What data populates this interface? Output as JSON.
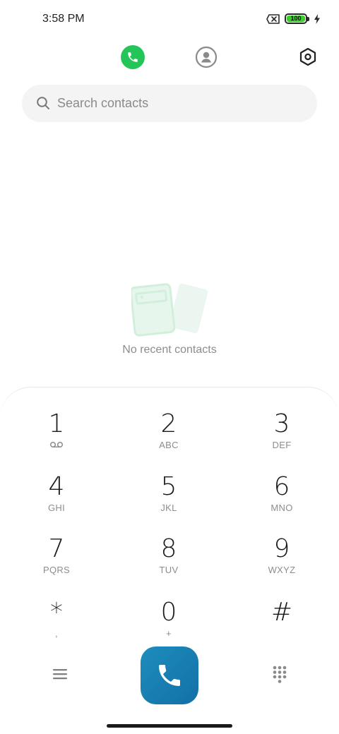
{
  "status_bar": {
    "time": "3:58 PM",
    "battery_level": "100",
    "icons": [
      "no-sim-icon",
      "battery-icon",
      "charging-bolt-icon"
    ]
  },
  "top_nav": {
    "tabs": [
      {
        "name": "phone-tab-icon",
        "active": true,
        "color": "#23c559"
      },
      {
        "name": "contacts-tab-icon",
        "active": false
      },
      {
        "name": "settings-icon",
        "active": false
      }
    ]
  },
  "search": {
    "placeholder": "Search contacts",
    "value": ""
  },
  "empty_state": {
    "message": "No recent contacts"
  },
  "dialpad": {
    "keys": [
      {
        "digit": "1",
        "letters": "",
        "extra_icon": "voicemail-icon"
      },
      {
        "digit": "2",
        "letters": "ABC"
      },
      {
        "digit": "3",
        "letters": "DEF"
      },
      {
        "digit": "4",
        "letters": "GHI"
      },
      {
        "digit": "5",
        "letters": "JKL"
      },
      {
        "digit": "6",
        "letters": "MNO"
      },
      {
        "digit": "7",
        "letters": "PQRS"
      },
      {
        "digit": "8",
        "letters": "TUV"
      },
      {
        "digit": "9",
        "letters": "WXYZ"
      },
      {
        "digit": "*",
        "letters": ","
      },
      {
        "digit": "0",
        "letters": "+"
      },
      {
        "digit": "#",
        "letters": ""
      }
    ]
  },
  "bottom_actions": {
    "menu_icon": "menu-icon",
    "call_icon": "phone-call-icon",
    "dialpad_toggle_icon": "dialpad-grid-icon",
    "call_button_color": "#1a84b8"
  }
}
